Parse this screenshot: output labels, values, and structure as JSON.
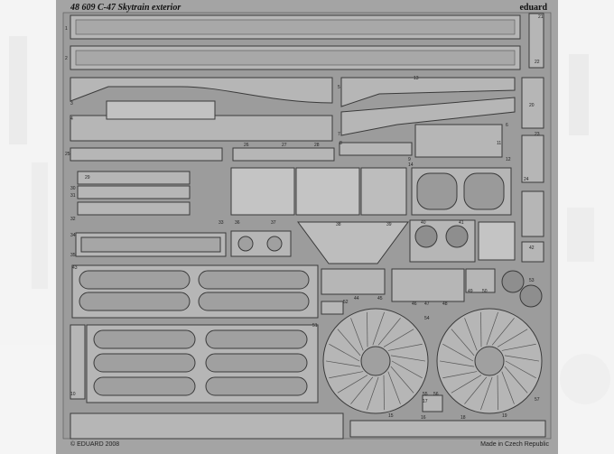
{
  "sheet": {
    "title": "48 609  C-47 Skytrain exterior",
    "brand": "eduard",
    "copyright": "© EDUARD 2008",
    "origin": "Made in Czech Republic"
  },
  "colors": {
    "fret": "#a4a4a4",
    "fret_dark": "#8c8c8c",
    "part": "#b6b6b6",
    "edge": "#3a3a3a",
    "background": "#ffffff",
    "ghost": "#dcdcdc"
  },
  "part_numbers": [
    "1",
    "2",
    "3",
    "4",
    "5",
    "6",
    "7",
    "8",
    "9",
    "10",
    "11",
    "12",
    "13",
    "14",
    "15",
    "16",
    "17",
    "18",
    "19",
    "20",
    "21",
    "22",
    "23",
    "24",
    "25",
    "26",
    "27",
    "28",
    "29",
    "30",
    "31",
    "32",
    "33",
    "34",
    "35",
    "36",
    "37",
    "38",
    "39",
    "40",
    "41",
    "42",
    "43",
    "44",
    "45",
    "46",
    "47",
    "48",
    "49",
    "50",
    "51",
    "52",
    "53",
    "54",
    "55",
    "56",
    "57"
  ]
}
